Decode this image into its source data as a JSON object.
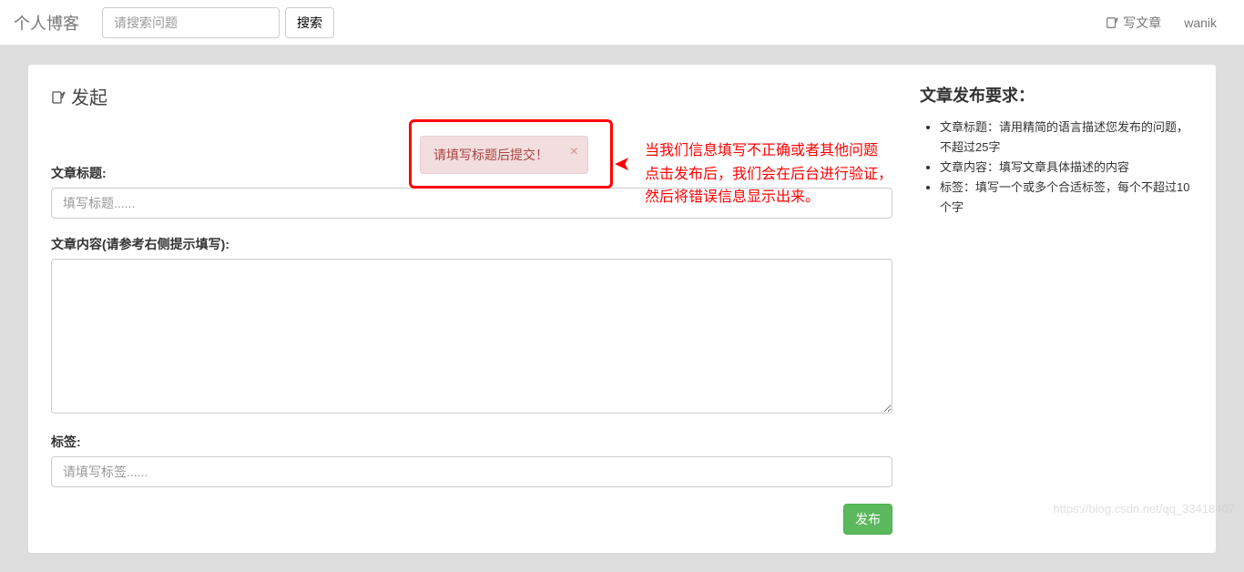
{
  "navbar": {
    "brand": "个人博客",
    "searchPlaceholder": "请搜索问题",
    "searchButton": "搜索",
    "writeArticle": "写文章",
    "username": "wanik"
  },
  "heading": "发起",
  "labels": {
    "title": "文章标题:",
    "content": "文章内容(请参考右侧提示填写):",
    "tags": "标签:"
  },
  "placeholders": {
    "title": "填写标题......",
    "tags": "请填写标签......"
  },
  "submit": "发布",
  "alert": {
    "message": "请填写标题后提交！"
  },
  "annotation": {
    "line1": "当我们信息填写不正确或者其他问题",
    "line2": "点击发布后，我们会在后台进行验证，",
    "line3": "然后将错误信息显示出来。"
  },
  "requirements": {
    "title": "文章发布要求：",
    "items": [
      "文章标题：请用精简的语言描述您发布的问题，不超过25字",
      "文章内容：填写文章具体描述的内容",
      "标签：填写一个或多个合适标签，每个不超过10个字"
    ]
  },
  "watermark": "https://blog.csdn.net/qq_33418407"
}
